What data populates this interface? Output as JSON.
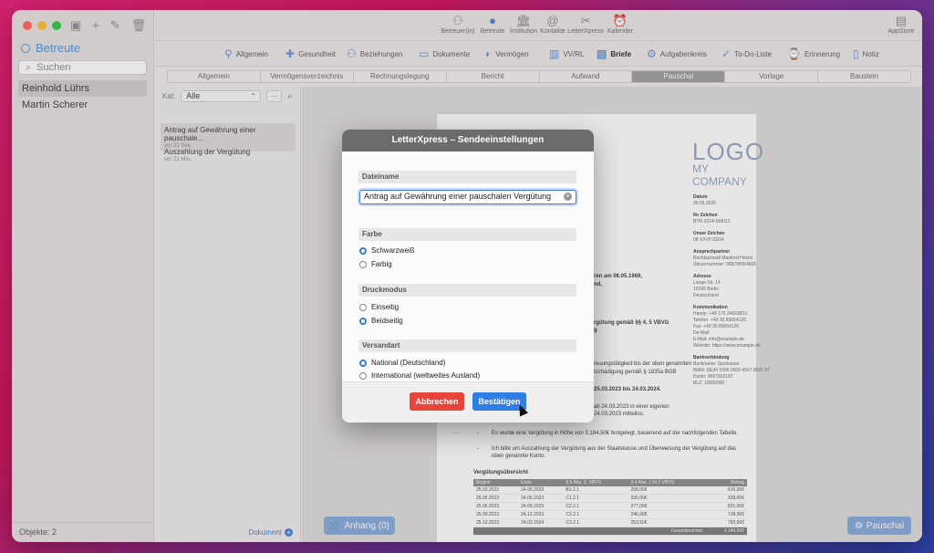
{
  "sidebar": {
    "title": "Betreute",
    "search_placeholder": "Suchen",
    "items": [
      "Reinhold Lührs",
      "Martin Scherer"
    ],
    "footer": "Objekte: 2"
  },
  "toolbar": {
    "items": [
      "Betreuer(in)",
      "Betreute",
      "Institution",
      "Kontakte",
      "LetterXpress",
      "Kalender"
    ],
    "appstore": "AppStore"
  },
  "subnav": {
    "items": [
      "Allgemein",
      "Gesundheit",
      "Beziehungen",
      "Dokumente",
      "Vermögen",
      "VV/RL",
      "Briefe",
      "Aufgabenkreis",
      "To-Do-Liste",
      "Erinnerung",
      "Notiz"
    ]
  },
  "segments": [
    "Allgemein",
    "Vermögensverzeichnis",
    "Rechnungslegung",
    "Bericht",
    "Aufwand",
    "Pauschal",
    "Vorlage",
    "Baustein"
  ],
  "list": {
    "filter_label": "Kat:",
    "filter_value": "Alle",
    "more": "···",
    "items": [
      {
        "title": "Antrag auf Gewährung einer pauschale...",
        "sub": "vor 21 Sek."
      },
      {
        "title": "Auszahlung der Vergütung",
        "sub": "vor 22 Min."
      }
    ],
    "dokument_link": "Dokument"
  },
  "preview": {
    "logo_line1": "LOGO",
    "logo_line2": "MY COMPANY",
    "info": {
      "datum_label": "Datum",
      "datum": "30.05.2025",
      "ihr_label": "Ihr Zeichen",
      "ihr": "BTR-2024-DM012",
      "unser_label": "Unser Zeichen",
      "unser": "08 XXVII 03/24",
      "partner_label": "Ansprechpartner",
      "partner": "Rechtsanwalt Manfred Hetzel",
      "partner2": "Steuernummer: 058/780/54835",
      "adresse_label": "Adresse",
      "adresse1": "Lange Str. 14",
      "adresse2": "10243 Berlin",
      "adresse3": "Deutschland",
      "komm_label": "Kommunikation",
      "komm1": "Handy: +49 170 24669823",
      "komm2": "Telefon: +49 30 89654126",
      "komm3": "Fax: +49 30 89654126",
      "komm4": "De-Mail:",
      "komm5": "E-Mail: info@example.de",
      "komm6": "Website: https://www.example.de",
      "bank_label": "Bankverbindung",
      "bank1": "Bankname: Sparkasse",
      "bank2": "IBAN: DE34 1006 0000 4567 8021 87",
      "bank3": "Konto: 4567802187",
      "bank4": "BLZ: 10050000"
    },
    "body": {
      "l1": "ren am 06.05.1969,",
      "l2": "nd,",
      "l3": "rgütung gemäß §§ 4, 5 VBVG",
      "l4": "g",
      "l5": "reuungstätigkeit bis der oben genannten",
      "l6": "tschädigung gemäß § 1835a BGB",
      "l7": "25.03.2023 bis 24.03.2024.",
      "l8": "ab 24.03.2023 in einer eigenen",
      "l9": "24.03.2023 mittellos.",
      "bullet1": "Es wurde eine Vergütung in Höhe von 3.184,50€ festgelegt, basierend auf der nachfolgenden Tabelle.",
      "bullet2": "Ich bitte um Auszahlung der Vergütung aus der Staatskasse und Überweisung der Vergütung auf das oben genannte Konto.",
      "dash1": "-",
      "dash2": "-",
      "ellipsis": "----",
      "table_title": "Vergütungsübersicht"
    },
    "table": {
      "headers": [
        "Beginn",
        "Ende",
        "§ 5 Abs. 3. VBVG",
        "§ 4 Abs. 1 Nr.2 VBVG",
        "Betrag"
      ],
      "rows": [
        [
          "25.03.2023",
          "24.05.2023",
          "B1.2.1",
          "258,00€",
          "516,00€"
        ],
        [
          "25.05.2023",
          "24.06.2023",
          "C1.2.1",
          "339,00€",
          "339,00€"
        ],
        [
          "25.06.2023",
          "24.09.2023",
          "C2.2.1",
          "277,00€",
          "831,00€"
        ],
        [
          "25.09.2023",
          "24.12.2023",
          "C3.2.1",
          "246,00€",
          "738,00€"
        ],
        [
          "25.12.2023",
          "24.03.2024",
          "C3.2.1",
          "253,50€",
          "760,50€"
        ]
      ],
      "sum_label": "Gesamtsumme:",
      "sum_value": "3.184,50€"
    },
    "anhang_button": "Anhang (0)",
    "pauschal_button": "Pauschal"
  },
  "dialog": {
    "title": "LetterXpress – Sendeeinstellungen",
    "dateiname_label": "Dateiname",
    "dateiname_value": "Antrag auf Gewährung einer pauschalen Vergütung",
    "farbe_label": "Farbe",
    "farbe_options": [
      "Schwarzweiß",
      "Farbig"
    ],
    "druck_label": "Druckmodus",
    "druck_options": [
      "Einseitig",
      "Beidseitig"
    ],
    "versand_label": "Versandart",
    "versand_options": [
      "National (Deutschland)",
      "International (weltweites Ausland)"
    ],
    "cancel": "Abbrechen",
    "confirm": "Bestätigen"
  }
}
